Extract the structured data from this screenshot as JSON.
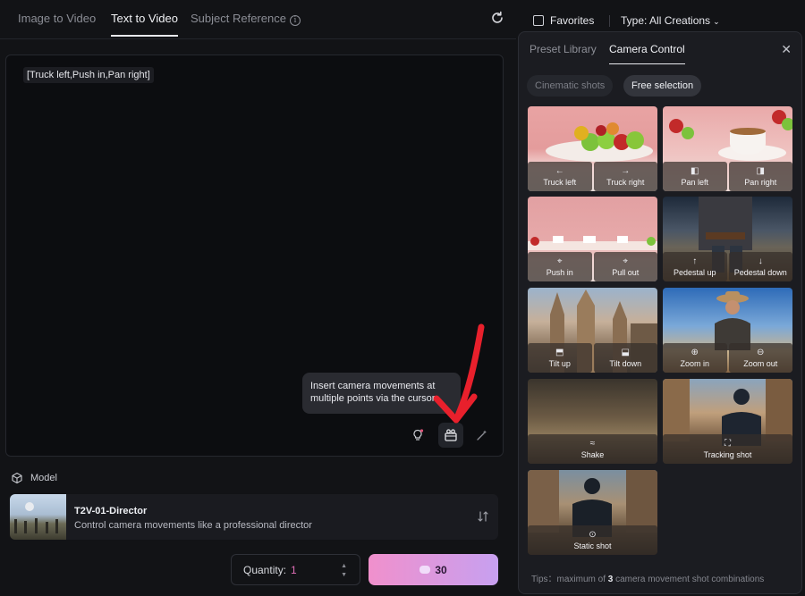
{
  "tabs": [
    {
      "label": "Image to Video",
      "active": false
    },
    {
      "label": "Text to Video",
      "active": true
    },
    {
      "label": "Subject Reference",
      "active": false
    }
  ],
  "prompt": {
    "chip": "[Truck left,Push in,Pan right]",
    "tooltip": "Insert camera movements at multiple points via the cursor"
  },
  "model": {
    "header": "Model",
    "name": "T2V-01-Director",
    "description": "Control camera movements like a professional director"
  },
  "quantity": {
    "label": "Quantity:",
    "value": "1"
  },
  "generate": {
    "cost": "30"
  },
  "topbar": {
    "favorites": "Favorites",
    "type": "Type:  All Creations"
  },
  "panel": {
    "tabs": [
      {
        "label": "Preset Library",
        "active": false
      },
      {
        "label": "Camera Control",
        "active": true
      }
    ],
    "pills": [
      {
        "label": "Cinematic shots",
        "active": false
      },
      {
        "label": "Free selection",
        "active": true
      }
    ],
    "cards": [
      {
        "options": [
          {
            "glyph": "←",
            "label": "Truck left"
          },
          {
            "glyph": "→",
            "label": "Truck right"
          }
        ]
      },
      {
        "options": [
          {
            "glyph": "◧",
            "label": "Pan left"
          },
          {
            "glyph": "◨",
            "label": "Pan right"
          }
        ]
      },
      {
        "options": [
          {
            "glyph": "⌖",
            "label": "Push in"
          },
          {
            "glyph": "⌖",
            "label": "Pull out"
          }
        ]
      },
      {
        "options": [
          {
            "glyph": "↑",
            "label": "Pedestal up"
          },
          {
            "glyph": "↓",
            "label": "Pedestal down"
          }
        ]
      },
      {
        "options": [
          {
            "glyph": "⬒",
            "label": "Tilt up"
          },
          {
            "glyph": "⬓",
            "label": "Tilt down"
          }
        ]
      },
      {
        "options": [
          {
            "glyph": "⊕",
            "label": "Zoom in"
          },
          {
            "glyph": "⊖",
            "label": "Zoom out"
          }
        ]
      },
      {
        "options": [
          {
            "glyph": "≈",
            "label": "Shake"
          }
        ]
      },
      {
        "options": [
          {
            "glyph": "⛶",
            "label": "Tracking shot"
          }
        ]
      },
      {
        "options": [
          {
            "glyph": "⊙",
            "label": "Static shot"
          }
        ]
      }
    ],
    "tips_prefix": "Tips：maximum of ",
    "tips_count": "3",
    "tips_suffix": " camera movement shot combinations"
  },
  "colors": {
    "accent_pink": "#e06fb6",
    "generate_from": "#f090cc",
    "generate_to": "#c7a0f0"
  }
}
